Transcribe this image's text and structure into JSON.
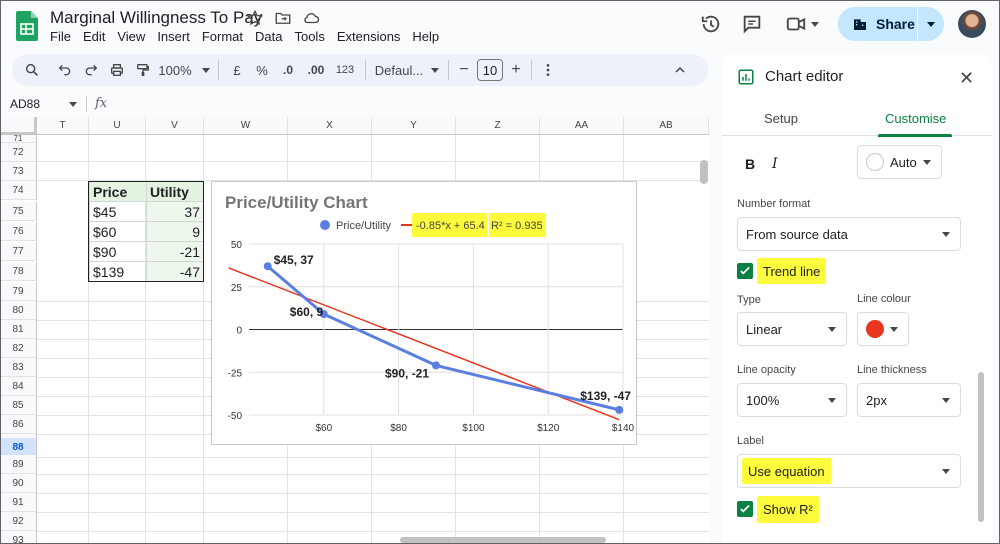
{
  "document": {
    "title": "Marginal Willingness To Pay"
  },
  "menu": [
    "File",
    "Edit",
    "View",
    "Insert",
    "Format",
    "Data",
    "Tools",
    "Extensions",
    "Help"
  ],
  "header": {
    "share_label": "Share"
  },
  "toolbar": {
    "zoom": "100%",
    "currency": "£",
    "percent": "%",
    "dec_decrease": ".0",
    "dec_increase": ".00",
    "number_format": "123",
    "font": "Defaul...",
    "font_size": "10",
    "minus": "−",
    "plus": "+"
  },
  "formula_bar": {
    "cell_ref": "AD88",
    "fx": "fx"
  },
  "grid": {
    "columns": [
      "T",
      "U",
      "V",
      "W",
      "X",
      "Y",
      "Z",
      "AA",
      "AB"
    ],
    "rows": [
      "71",
      "72",
      "73",
      "74",
      "75",
      "76",
      "77",
      "78",
      "79",
      "80",
      "81",
      "82",
      "83",
      "84",
      "85",
      "86",
      "87",
      "88",
      "89",
      "90",
      "91",
      "92",
      "93"
    ],
    "selected_row": "88"
  },
  "table": {
    "headers": [
      "Price",
      "Utility"
    ],
    "rows": [
      [
        "$45",
        "37"
      ],
      [
        "$60",
        "9"
      ],
      [
        "$90",
        "-21"
      ],
      [
        "$139",
        "-47"
      ]
    ]
  },
  "chart_data": {
    "type": "line",
    "title": "Price/Utility Chart",
    "x": [
      45,
      60,
      90,
      139
    ],
    "series": [
      {
        "name": "Price/Utility",
        "values": [
          37,
          9,
          -21,
          -47
        ],
        "color": "#5b7fe0"
      }
    ],
    "point_labels": [
      "$45, 37",
      "$60, 9",
      "$90, -21",
      "$139, -47"
    ],
    "trendline": {
      "type": "linear",
      "slope": -0.85,
      "intercept": 65.4,
      "label": "-0.85*x + 65.4",
      "r2_label": "R² = 0.935",
      "color": "#e8351f"
    },
    "x_ticks": [
      "$60",
      "$80",
      "$100",
      "$120",
      "$140"
    ],
    "x_tick_values": [
      60,
      80,
      100,
      120,
      140
    ],
    "y_ticks": [
      "50",
      "25",
      "0",
      "-25",
      "-50"
    ],
    "y_tick_values": [
      50,
      25,
      0,
      -25,
      -50
    ],
    "xlim": [
      40,
      140
    ],
    "ylim": [
      -50,
      50
    ],
    "legend_position": "top",
    "grid": true
  },
  "editor": {
    "title": "Chart editor",
    "tabs": [
      "Setup",
      "Customise"
    ],
    "active_tab": "Customise",
    "bold": "B",
    "italic": "I",
    "text_colour": "Auto",
    "number_format_label": "Number format",
    "number_format_value": "From source data",
    "trend_line_label": "Trend line",
    "type_label": "Type",
    "type_value": "Linear",
    "line_colour_label": "Line colour",
    "line_colour": "#e8351f",
    "line_opacity_label": "Line opacity",
    "line_opacity_value": "100%",
    "line_thickness_label": "Line thickness",
    "line_thickness_value": "2px",
    "label_label": "Label",
    "label_value": "Use equation",
    "show_r2_label": "Show R²",
    "highlight_color": "#fdfb3c",
    "accent_color": "#0b8043"
  }
}
